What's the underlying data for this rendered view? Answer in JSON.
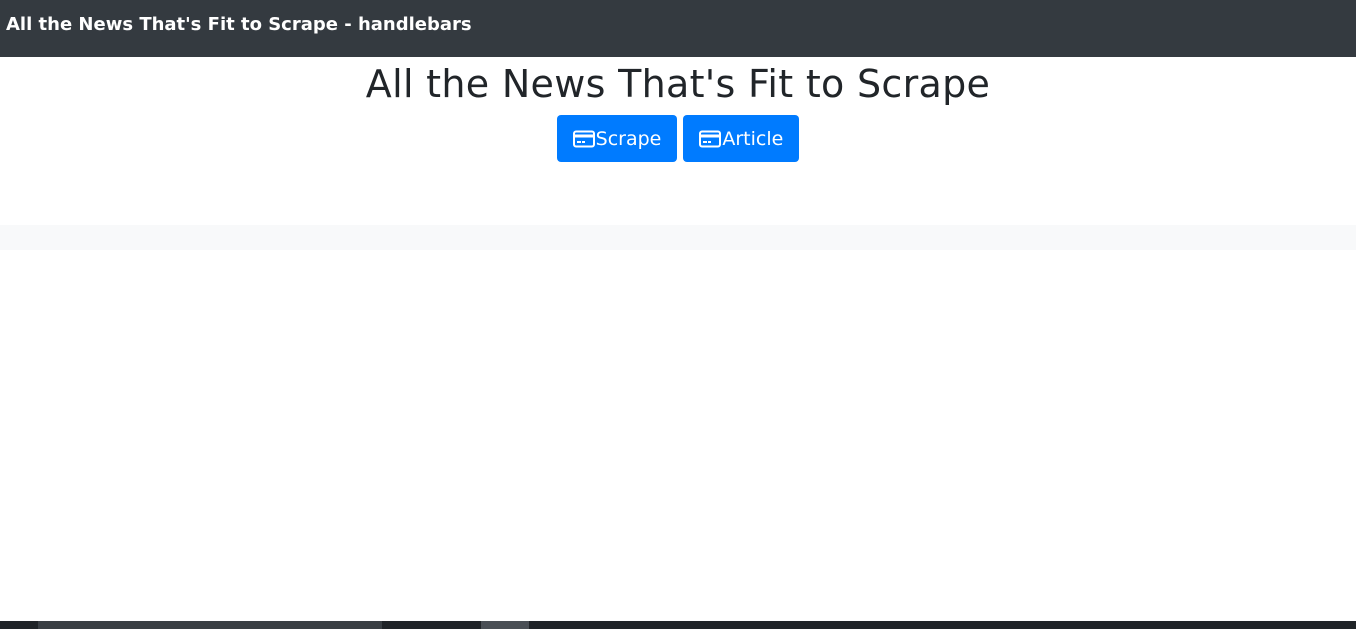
{
  "navbar": {
    "brand": "All the News That's Fit to Scrape - handlebars"
  },
  "header": {
    "title": "All the News That's Fit to Scrape"
  },
  "buttons": [
    {
      "label": "Scrape",
      "icon": "credit-card-icon"
    },
    {
      "label": "Article",
      "icon": "credit-card-icon"
    }
  ],
  "colors": {
    "navbar_bg": "#343a40",
    "primary": "#007bff",
    "band_bg": "#f8f9fa",
    "text": "#212529"
  }
}
